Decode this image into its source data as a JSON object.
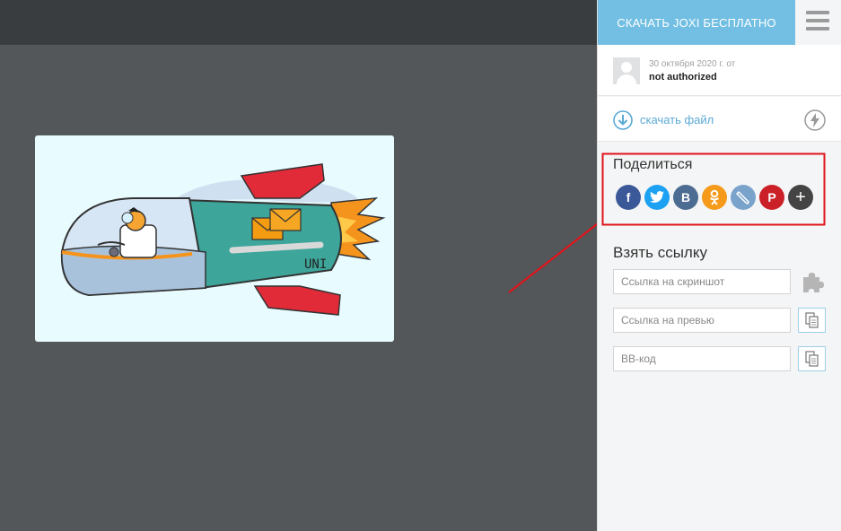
{
  "sidebar": {
    "download_app_label": "СКАЧАТЬ JOXI БЕСПЛАТНО",
    "meta": {
      "date": "30 октября 2020 г. от",
      "user": "not authorized"
    },
    "download_file_label": "скачать файл",
    "share": {
      "title": "Поделиться",
      "icons": [
        {
          "name": "facebook-icon",
          "glyph": "f",
          "color": "#3b5998"
        },
        {
          "name": "twitter-icon",
          "glyph": "t",
          "color": "#1da1f2"
        },
        {
          "name": "vk-icon",
          "glyph": "B",
          "color": "#4c6c91"
        },
        {
          "name": "odnoklassniki-icon",
          "glyph": "ok",
          "color": "#f59a1b"
        },
        {
          "name": "livejournal-icon",
          "glyph": "lj",
          "color": "#7aa3cc"
        },
        {
          "name": "pinterest-icon",
          "glyph": "P",
          "color": "#cb2027"
        },
        {
          "name": "more-share-icon",
          "glyph": "+",
          "color": "#444444"
        }
      ]
    },
    "links": {
      "title": "Взять ссылку",
      "screenshot_placeholder": "Ссылка на скриншот",
      "preview_placeholder": "Ссылка на превью",
      "bbcode_placeholder": "BB-код"
    }
  },
  "colors": {
    "accent": "#72bfe3",
    "annotation": "#e0141b"
  },
  "image": {
    "rocket_label": "UNI"
  }
}
